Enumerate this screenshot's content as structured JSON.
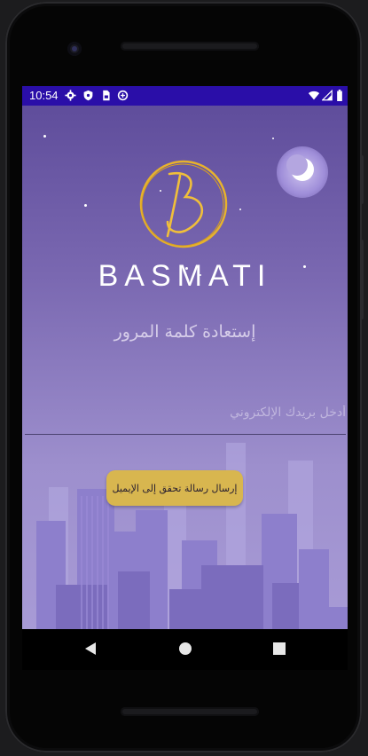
{
  "status_bar": {
    "time": "10:54",
    "left_icons": [
      "settings-icon",
      "shield-icon",
      "sim-card-icon",
      "data-saver-icon"
    ],
    "right_icons": [
      "wifi-icon",
      "signal-icon",
      "battery-icon"
    ],
    "background_color": "#2a0ea8"
  },
  "app": {
    "logo_letter": "B",
    "brand_name": "BASMATI",
    "title": "إستعادة كلمة المرور",
    "email_field": {
      "placeholder": "أدخل بريدك الإلكتروني",
      "value": ""
    },
    "send_button_label": "إرسال رسالة تحقق إلى الإيميل",
    "accent_color": "#d8b64f"
  },
  "navigation_bar": {
    "buttons": [
      "back-icon",
      "home-icon",
      "recents-icon"
    ]
  }
}
